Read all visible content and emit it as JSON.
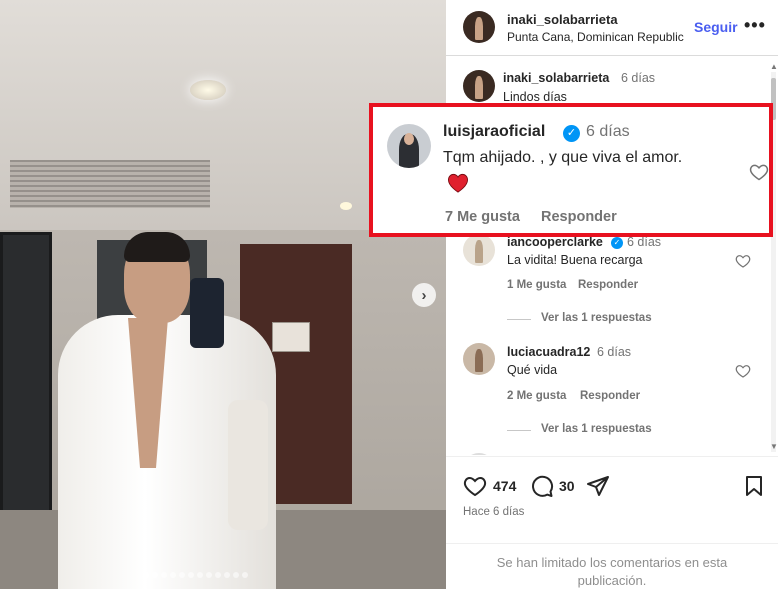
{
  "post": {
    "username": "inaki_solabarrieta",
    "location": "Punta Cana, Dominican Republic",
    "follow_label": "Seguir",
    "more_label": "•••",
    "carousel": {
      "slide_count": 12,
      "active_index": 0
    }
  },
  "comments": [
    {
      "username": "inaki_solabarrieta",
      "time": "6 días",
      "text": "Lindos días"
    },
    {
      "username": "iancooperclarke",
      "verified": true,
      "time": "6 días",
      "text": "La vidita! Buena recarga",
      "likes": "1 Me gusta",
      "reply_label": "Responder",
      "view_replies": "Ver las 1 respuestas"
    },
    {
      "username": "luciacuadra12",
      "time": "6 días",
      "text": "Qué vida",
      "likes": "2 Me gusta",
      "reply_label": "Responder",
      "view_replies": "Ver las 1 respuestas"
    }
  ],
  "highlight": {
    "username": "luisjaraoficial",
    "verified": true,
    "time": "6 días",
    "text": "Tqm ahijado. , y que viva el amor.",
    "likes": "7 Me gusta",
    "reply_label": "Responder",
    "border_color": "#e8111f"
  },
  "actions": {
    "like_count": "474",
    "comment_count": "30",
    "posted_ago": "Hace 6 días",
    "comments_limited": "Se han limitado los comentarios en esta publicación."
  },
  "colors": {
    "link": "#4a5ef0",
    "verified": "#0095f6",
    "muted": "#737373"
  }
}
